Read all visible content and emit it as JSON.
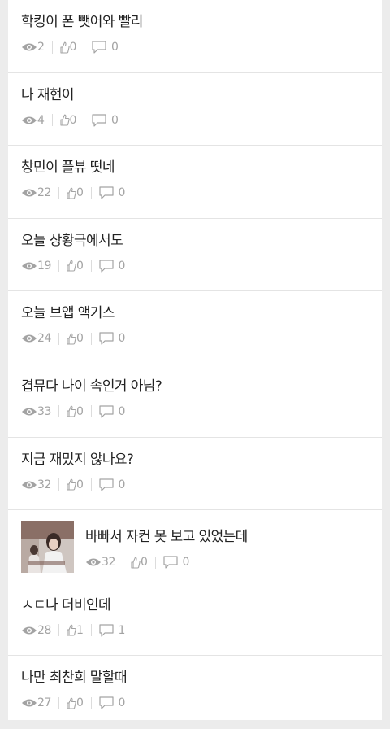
{
  "posts": [
    {
      "title": "학킹이 폰 뺏어와 빨리",
      "views": "2",
      "likes": "0",
      "comments": "0"
    },
    {
      "title": "나 재현이",
      "views": "4",
      "likes": "0",
      "comments": "0"
    },
    {
      "title": "창민이 플뷰 떳네",
      "views": "22",
      "likes": "0",
      "comments": "0"
    },
    {
      "title": "오늘 상황극에서도",
      "views": "19",
      "likes": "0",
      "comments": "0"
    },
    {
      "title": "오늘 브앱 액기스",
      "views": "24",
      "likes": "0",
      "comments": "0"
    },
    {
      "title": "겹뮤다 나이 속인거 아님?",
      "views": "33",
      "likes": "0",
      "comments": "0"
    },
    {
      "title": "지금 재밌지 않나요?",
      "views": "32",
      "likes": "0",
      "comments": "0"
    },
    {
      "title": "바빠서 자컨 못 보고 있었는데",
      "views": "32",
      "likes": "0",
      "comments": "0",
      "has_thumbnail": true
    },
    {
      "title": "ㅅㄷ나 더비인데",
      "views": "28",
      "likes": "1",
      "comments": "1"
    },
    {
      "title": "나만 최찬희 말할때",
      "views": "27",
      "likes": "0",
      "comments": "0"
    }
  ],
  "icons": {
    "views": "eye-icon",
    "likes": "thumbs-up-icon",
    "comments": "comment-icon"
  },
  "colors": {
    "meta_text": "#a3a3a3",
    "title_text": "#222222",
    "divider": "#e4e4e4",
    "page_bg": "#ececec"
  }
}
